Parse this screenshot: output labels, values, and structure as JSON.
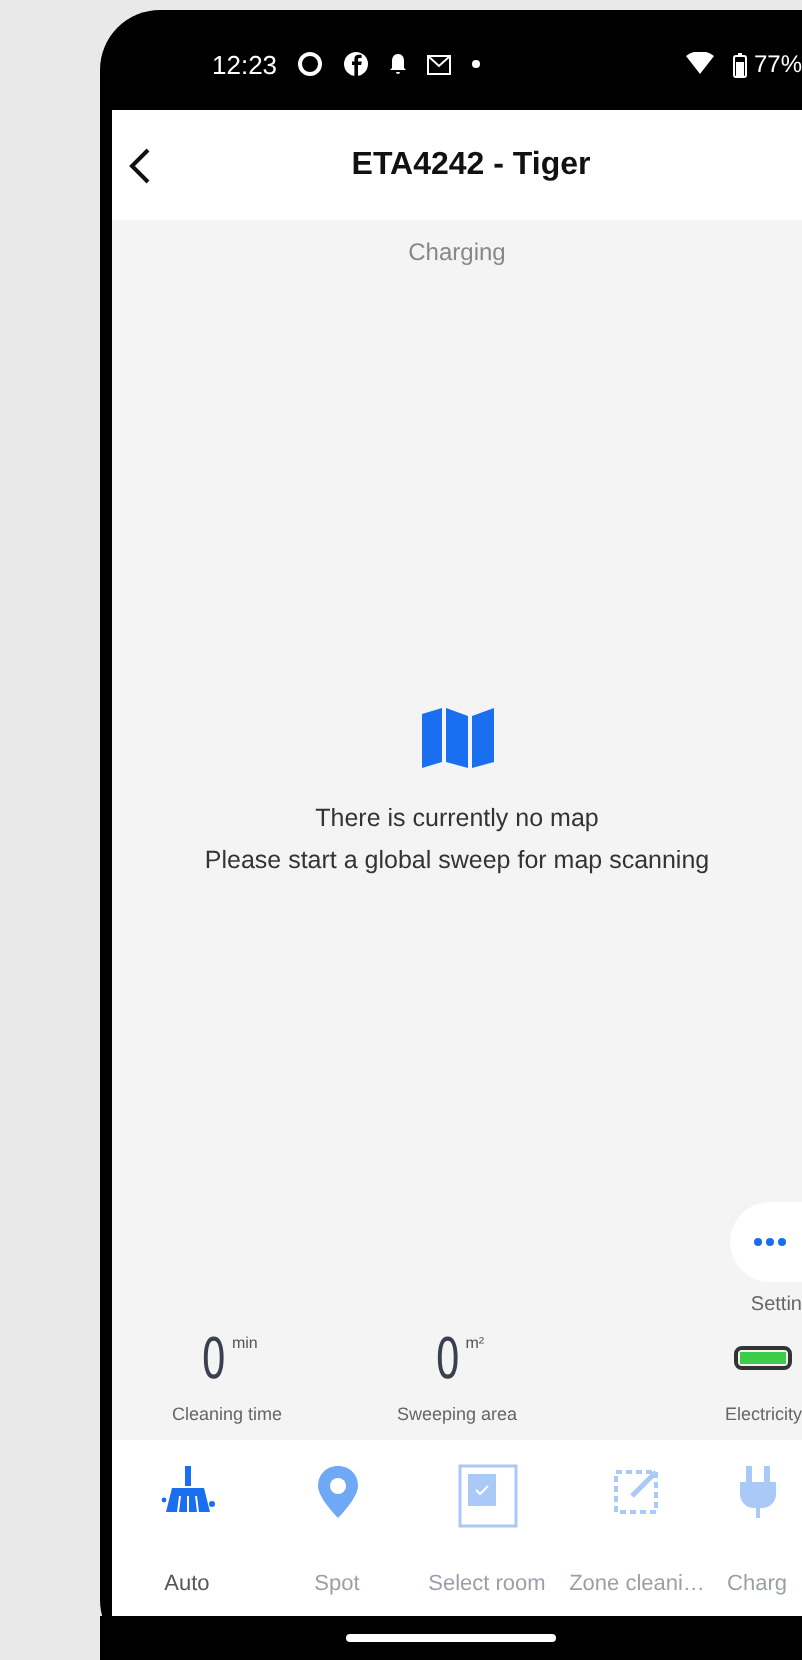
{
  "status_bar": {
    "time": "12:23",
    "battery": "77%"
  },
  "header": {
    "title": "ETA4242 - Tiger"
  },
  "status": "Charging",
  "empty_map": {
    "lines": [
      "There is currently no map",
      "Please start a global sweep for map scanning"
    ]
  },
  "settings": {
    "label": "Settin"
  },
  "stats": [
    {
      "kind": "number",
      "value": "0",
      "unit": "min",
      "label": "Cleaning time"
    },
    {
      "kind": "number",
      "value": "0",
      "unit": "m²",
      "label": "Sweeping area"
    },
    {
      "kind": "battery",
      "level": 1,
      "label": "Electricity"
    }
  ],
  "modes": [
    {
      "kind": "auto",
      "label": "Auto",
      "selected": true
    },
    {
      "kind": "spot",
      "label": "Spot",
      "selected": false
    },
    {
      "kind": "room",
      "label": "Select room",
      "selected": false
    },
    {
      "kind": "zone",
      "label": "Zone cleani…",
      "selected": false
    },
    {
      "kind": "charge",
      "label": "Charg",
      "selected": false
    }
  ]
}
